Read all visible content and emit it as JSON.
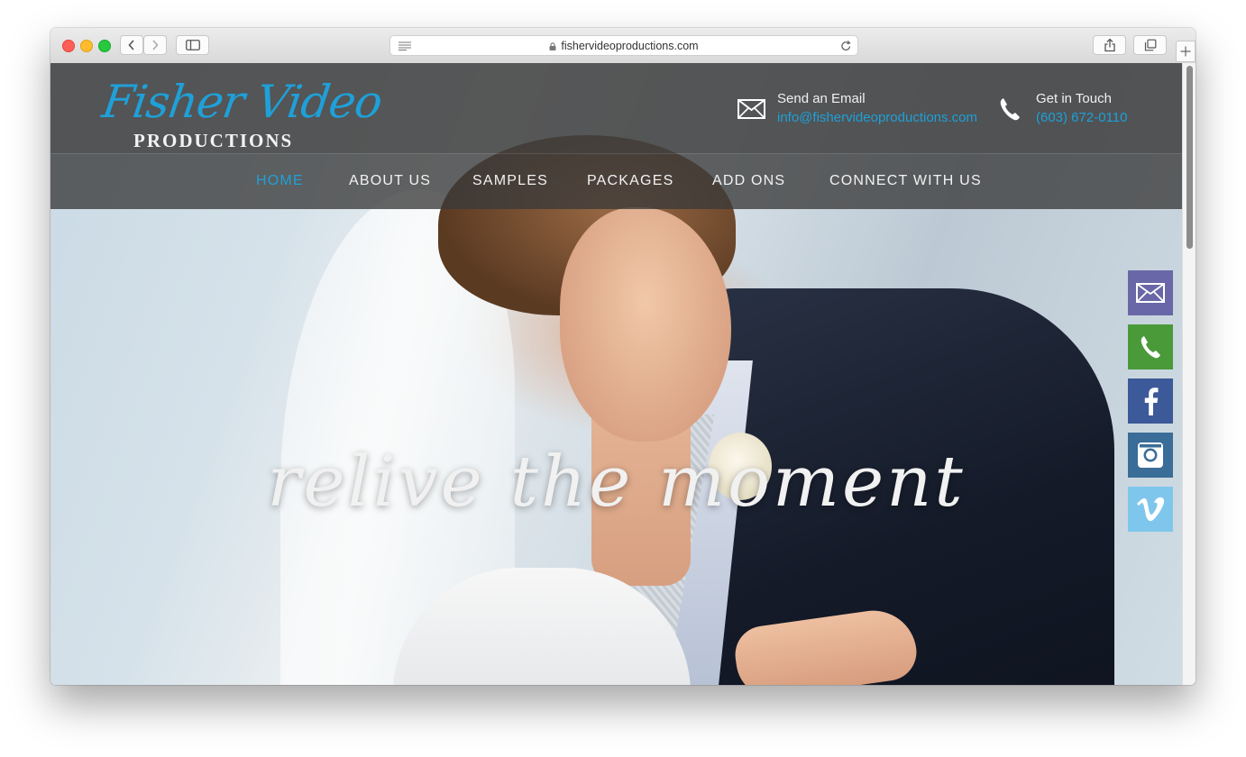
{
  "browser": {
    "url": "fishervideoproductions.com"
  },
  "site": {
    "logo_script": "Fisher Video",
    "logo_sub": "PRODUCTIONS",
    "email": {
      "label": "Send an Email",
      "value": "info@fishervideoproductions.com"
    },
    "phone": {
      "label": "Get in Touch",
      "value": "(603) 672-0110"
    },
    "nav": [
      {
        "label": "HOME",
        "active": true
      },
      {
        "label": "ABOUT US"
      },
      {
        "label": "SAMPLES"
      },
      {
        "label": "PACKAGES"
      },
      {
        "label": "ADD ONS"
      },
      {
        "label": "CONNECT WITH US"
      }
    ],
    "hero": {
      "tagline": "relive the moment"
    },
    "social": [
      {
        "icon": "email-icon",
        "color": "#6a67a8"
      },
      {
        "icon": "phone-icon",
        "color": "#4a9a3a"
      },
      {
        "icon": "facebook-icon",
        "color": "#3c5a99"
      },
      {
        "icon": "instagram-icon",
        "color": "#3a6d98"
      },
      {
        "icon": "vimeo-icon",
        "color": "#7fc6ec"
      }
    ],
    "accent_color": "#1fa0d8"
  }
}
